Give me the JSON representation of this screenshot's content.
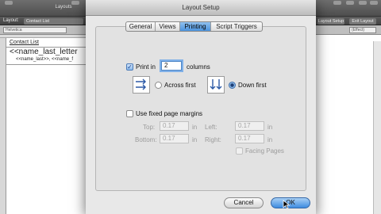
{
  "background": {
    "toolbar_caption": "Layouts",
    "layout_label": "Layout:",
    "layout_name": "Contact List",
    "right_buttons": [
      "Layout Setup",
      "Exit Layout"
    ],
    "format_fields": [
      "Helvetica",
      "(Effect)"
    ],
    "canvas": {
      "header_text": "Contact List",
      "field_text": "<<name_last_letter",
      "body_text": "<<name_last>>, <<name_f"
    }
  },
  "dialog": {
    "title": "Layout Setup",
    "tabs": [
      {
        "label": "General",
        "active": false
      },
      {
        "label": "Views",
        "active": false
      },
      {
        "label": "Printing",
        "active": true
      },
      {
        "label": "Script Triggers",
        "active": false
      }
    ],
    "print_in": {
      "checked": true,
      "label": "Print in",
      "value": "2",
      "suffix": "columns"
    },
    "order": {
      "across_label": "Across first",
      "down_label": "Down first",
      "selected": "down"
    },
    "margins": {
      "checkbox_label": "Use fixed page margins",
      "checked": false,
      "top_label": "Top:",
      "top_value": "0.17",
      "top_unit": "in",
      "left_label": "Left:",
      "left_value": "0.17",
      "left_unit": "in",
      "bottom_label": "Bottom:",
      "bottom_value": "0.17",
      "bottom_unit": "in",
      "right_label": "Right:",
      "right_value": "0.17",
      "right_unit": "in",
      "facing_label": "Facing Pages"
    },
    "buttons": {
      "cancel": "Cancel",
      "ok": "OK"
    }
  }
}
